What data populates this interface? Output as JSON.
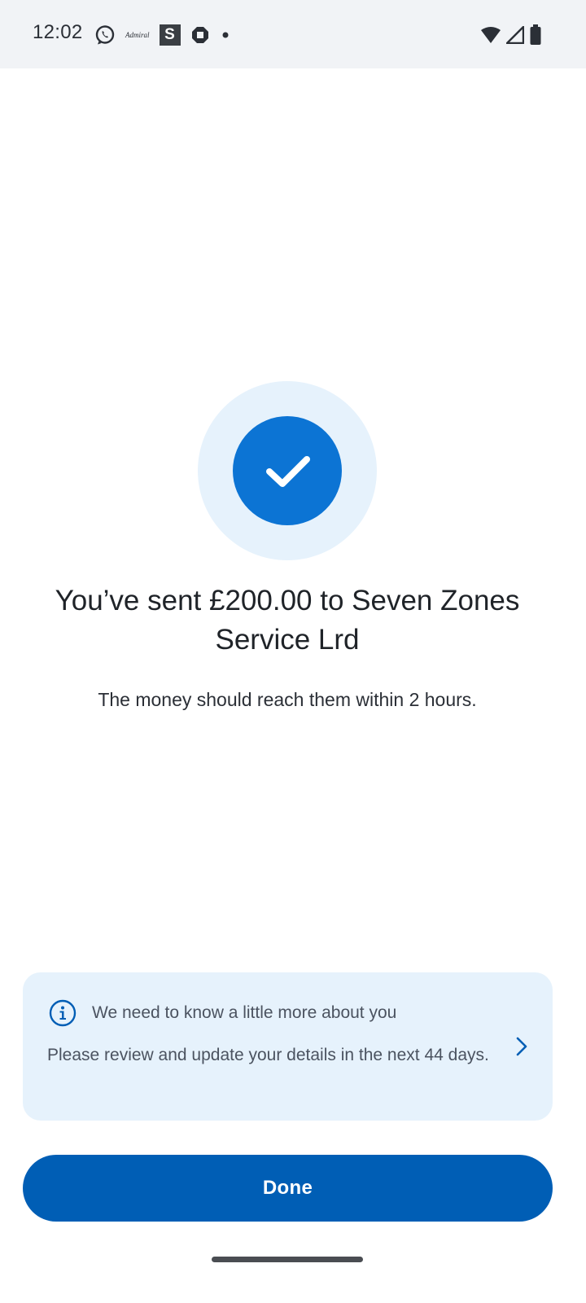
{
  "status_bar": {
    "time": "12:02",
    "left_icons": [
      "whatsapp-icon",
      "admiral-icon",
      "s-app-icon",
      "chase-icon",
      "dot-icon"
    ],
    "admiral_label": "Admiral",
    "s_label": "S",
    "right_icons": [
      "wifi-icon",
      "cell-signal-icon",
      "battery-icon"
    ]
  },
  "success": {
    "icon": "checkmark-icon",
    "headline": "You’ve sent £200.00 to Seven Zones Service Lrd",
    "message": "The money should reach them within 2 hours."
  },
  "info_card": {
    "icon": "info-icon",
    "title": "We need to know a little more about you",
    "body": "Please review and update your details in the next 44 days.",
    "chevron_icon": "chevron-right-icon"
  },
  "actions": {
    "done_label": "Done"
  },
  "colors": {
    "primary": "#005eb5",
    "success_blue": "#0c74d4",
    "light_blue": "#e6f2fc",
    "status_bar_bg": "#f1f3f6"
  }
}
